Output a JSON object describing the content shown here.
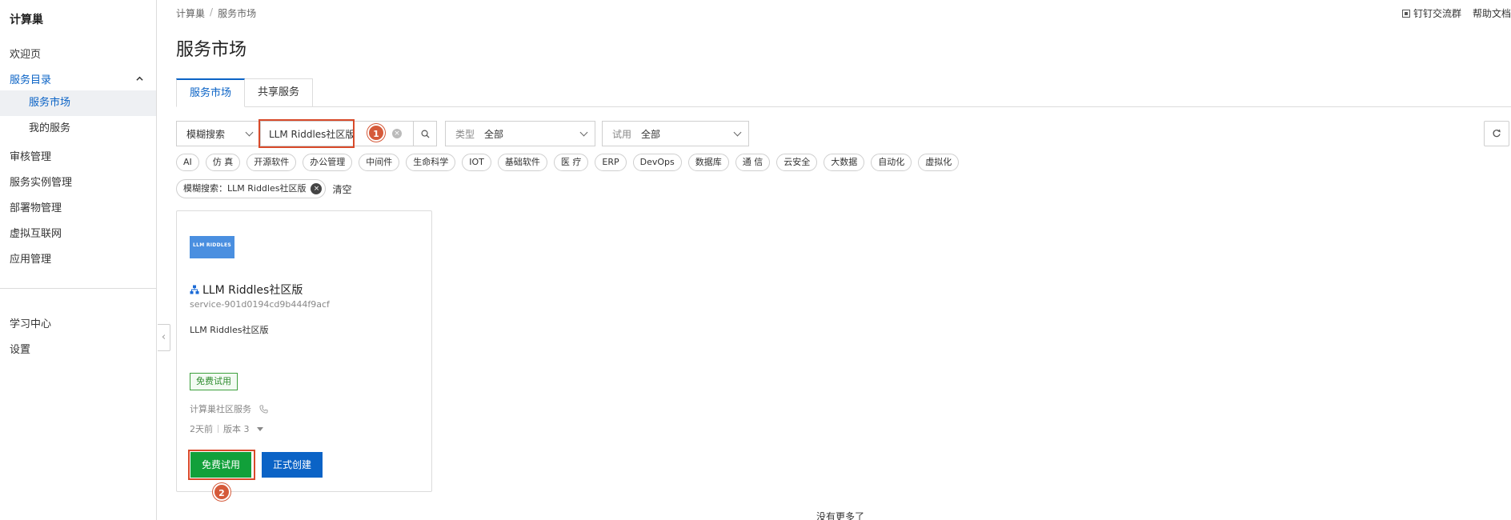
{
  "sidebar": {
    "brand": "计算巢",
    "items": [
      {
        "label": "欢迎页"
      },
      {
        "label": "服务目录"
      },
      {
        "label": "服务市场"
      },
      {
        "label": "我的服务"
      },
      {
        "label": "审核管理"
      },
      {
        "label": "服务实例管理"
      },
      {
        "label": "部署物管理"
      },
      {
        "label": "虚拟互联网"
      },
      {
        "label": "应用管理"
      },
      {
        "label": "学习中心"
      },
      {
        "label": "设置"
      }
    ]
  },
  "top_links": {
    "dingtalk": "钉钉交流群",
    "help": "帮助文档"
  },
  "breadcrumb": [
    "计算巢",
    "/",
    "服务市场"
  ],
  "page_title": "服务市场",
  "tabs": [
    {
      "label": "服务市场",
      "active": true
    },
    {
      "label": "共享服务",
      "active": false
    }
  ],
  "filters": {
    "search_mode": "模糊搜索",
    "search_value": "LLM Riddles社区版",
    "type_prefix": "类型",
    "type_value": "全部",
    "trial_prefix": "试用",
    "trial_value": "全部"
  },
  "categories": [
    "AI",
    "仿 真",
    "开源软件",
    "办公管理",
    "中间件",
    "生命科学",
    "IOT",
    "基础软件",
    "医 疗",
    "ERP",
    "DevOps",
    "数据库",
    "通 信",
    "云安全",
    "大数据",
    "自动化",
    "虚拟化"
  ],
  "active_filter": {
    "tag": "模糊搜索：LLM Riddles社区版",
    "clear": "清空"
  },
  "markers": [
    "1",
    "2"
  ],
  "card": {
    "logo_text": "LLM RIDDLES",
    "title": "LLM Riddles社区版",
    "service_id": "service-901d0194cd9b444f9acf",
    "description": "LLM Riddles社区版",
    "badge": "免费试用",
    "provider": "计算巢社区服务",
    "age": "2天前",
    "version": "版本 3",
    "trial_button": "免费试用",
    "create_button": "正式创建"
  },
  "no_more": "没有更多了",
  "colors": {
    "primary": "#0b63c6",
    "trial_green": "#11a03a",
    "highlight_red": "#d84a2a"
  }
}
